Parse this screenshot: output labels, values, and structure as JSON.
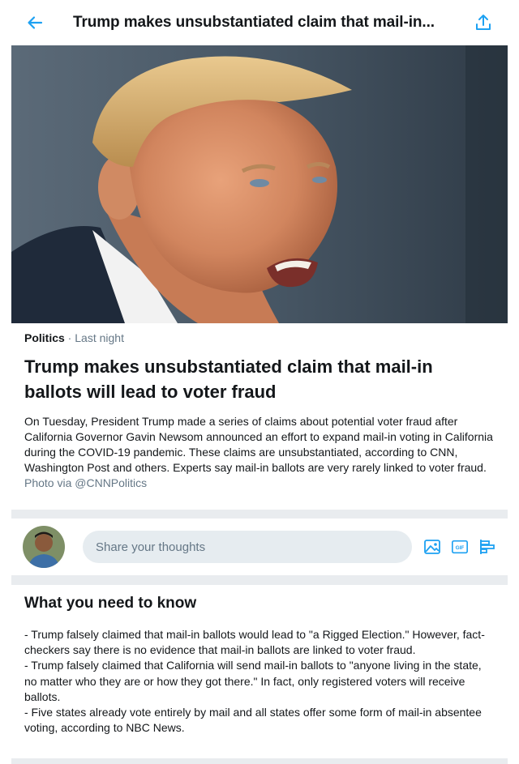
{
  "header": {
    "back_icon": "back-arrow-icon",
    "title": "Trump makes unsubstantiated claim that mail-in...",
    "share_icon": "share-icon",
    "accent": "#1da1f2"
  },
  "article": {
    "category": "Politics",
    "separator": " · ",
    "time": "Last night",
    "headline": "Trump makes unsubstantiated claim that mail-in ballots will lead to voter fraud",
    "summary": "On Tuesday, President Trump made a series of claims about potential voter fraud after California Governor Gavin Newsom announced an effort to expand mail-in voting in California during the COVID-19 pandemic. These claims are unsubstantiated, according to CNN, Washington Post and others. Experts say mail-in ballots are very rarely linked to voter fraud.",
    "credit": "Photo via @CNNPolitics"
  },
  "compose": {
    "placeholder": "Share your thoughts",
    "tools": [
      "image-icon",
      "gif-icon",
      "poll-icon"
    ]
  },
  "know": {
    "title": "What you need to know",
    "items": [
      "- Trump falsely claimed that mail-in ballots would lead to \"a Rigged Election.\" However, fact-checkers say there is no evidence that mail-in ballots are linked to voter fraud.",
      "- Trump falsely claimed that California will send mail-in ballots to \"anyone living in the state, no matter who they are or how they got there.\" In fact, only registered voters will receive ballots.",
      "- Five states already vote entirely by mail and all states offer some form of mail-in absentee voting, according to NBC News."
    ]
  }
}
